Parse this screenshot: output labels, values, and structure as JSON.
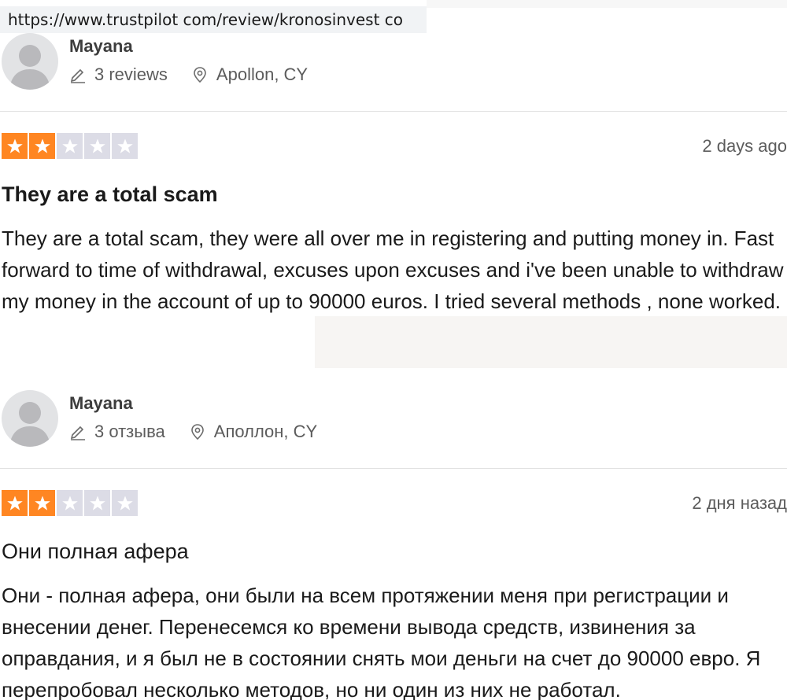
{
  "browser": {
    "url": "https://www.trustpilot com/review/kronosinvest co"
  },
  "reviews": [
    {
      "reviewer": {
        "name": "Mayana",
        "reviews_count": "3 reviews",
        "location": "Apollon, CY"
      },
      "rating": 2,
      "date": "2 days ago",
      "title": "They are a total scam",
      "body": "They are a total scam, they were all over me in registering and putting money in. Fast forward to time of withdrawal, excuses upon excuses and i've been unable to withdraw my money in the account of up to 90000 euros. I tried several methods , none worked."
    },
    {
      "reviewer": {
        "name": "Mayana",
        "reviews_count": "3 отзыва",
        "location": "Аполлон, CY"
      },
      "rating": 2,
      "date": "2 дня назад",
      "title": "Они полная афера",
      "body": "Они - полная афера, они были на всем протяжении меня при регистрации и внесении денег. Перенесемся ко времени вывода средств, извинения за оправдания, и я был не в состоянии снять мои деньги на счет до 90000 евро. Я перепробовал несколько методов, но ни один из них не работал."
    }
  ],
  "icons": {
    "avatar": "user-avatar-icon",
    "reviews_count": "pencil-icon",
    "location": "map-pin-icon",
    "star": "star-icon"
  },
  "colors": {
    "star_filled": "#ff8622",
    "star_empty": "#dcdce6",
    "avatar_bg": "#e2e3e5",
    "meta_text": "#5c5c5c"
  }
}
